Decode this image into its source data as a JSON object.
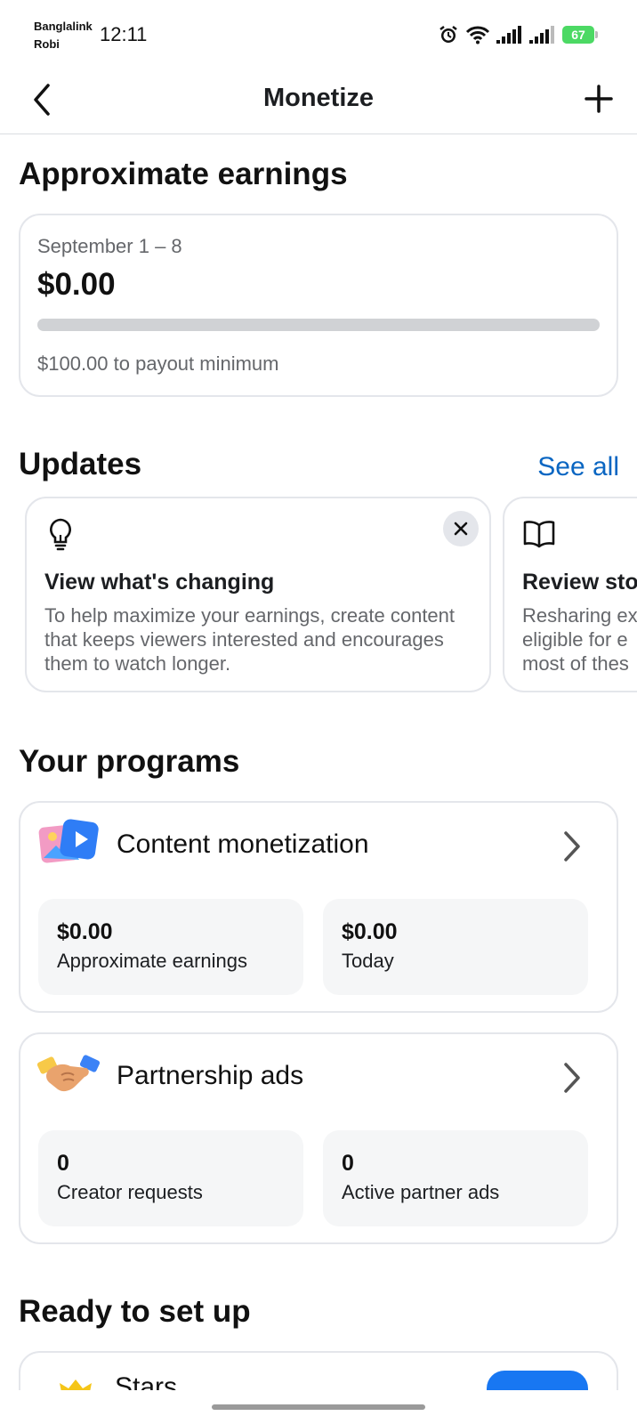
{
  "status_bar": {
    "carrier_1": "Banglalink",
    "carrier_2": "Robi",
    "time": "12:11",
    "battery": "67",
    "icons": [
      "alarm-icon",
      "wifi-icon",
      "signal-icon",
      "signal-icon",
      "battery-icon"
    ]
  },
  "header": {
    "title": "Monetize",
    "back_icon": "chevron-left-icon",
    "add_icon": "plus-icon"
  },
  "earnings": {
    "heading": "Approximate earnings",
    "date_range": "September 1 – 8",
    "amount": "$0.00",
    "progress_fraction": 0,
    "payout_note": "$100.00 to payout minimum"
  },
  "updates": {
    "heading": "Updates",
    "see_all": "See all",
    "cards": [
      {
        "icon": "lightbulb-icon",
        "title": "View what's changing",
        "body": "To help maximize your earnings, create content that keeps viewers interested and encourages them to watch longer."
      },
      {
        "icon": "book-icon",
        "title": "Review sto",
        "body_lines": [
          "Resharing ex",
          "eligible for e",
          "most of thes"
        ]
      }
    ]
  },
  "programs": {
    "heading": "Your programs",
    "items": [
      {
        "title": "Content monetization",
        "icon": "content-monetization-icon",
        "stats": [
          {
            "value": "$0.00",
            "label": "Approximate earnings"
          },
          {
            "value": "$0.00",
            "label": "Today"
          }
        ]
      },
      {
        "title": "Partnership ads",
        "icon": "handshake-icon",
        "stats": [
          {
            "value": "0",
            "label": "Creator requests"
          },
          {
            "value": "0",
            "label": "Active partner ads"
          }
        ]
      }
    ]
  },
  "ready": {
    "heading": "Ready to set up",
    "first_item": "Stars"
  },
  "colors": {
    "accent": "#1877f2",
    "link": "#0a66c2",
    "battery": "#4cd964"
  }
}
